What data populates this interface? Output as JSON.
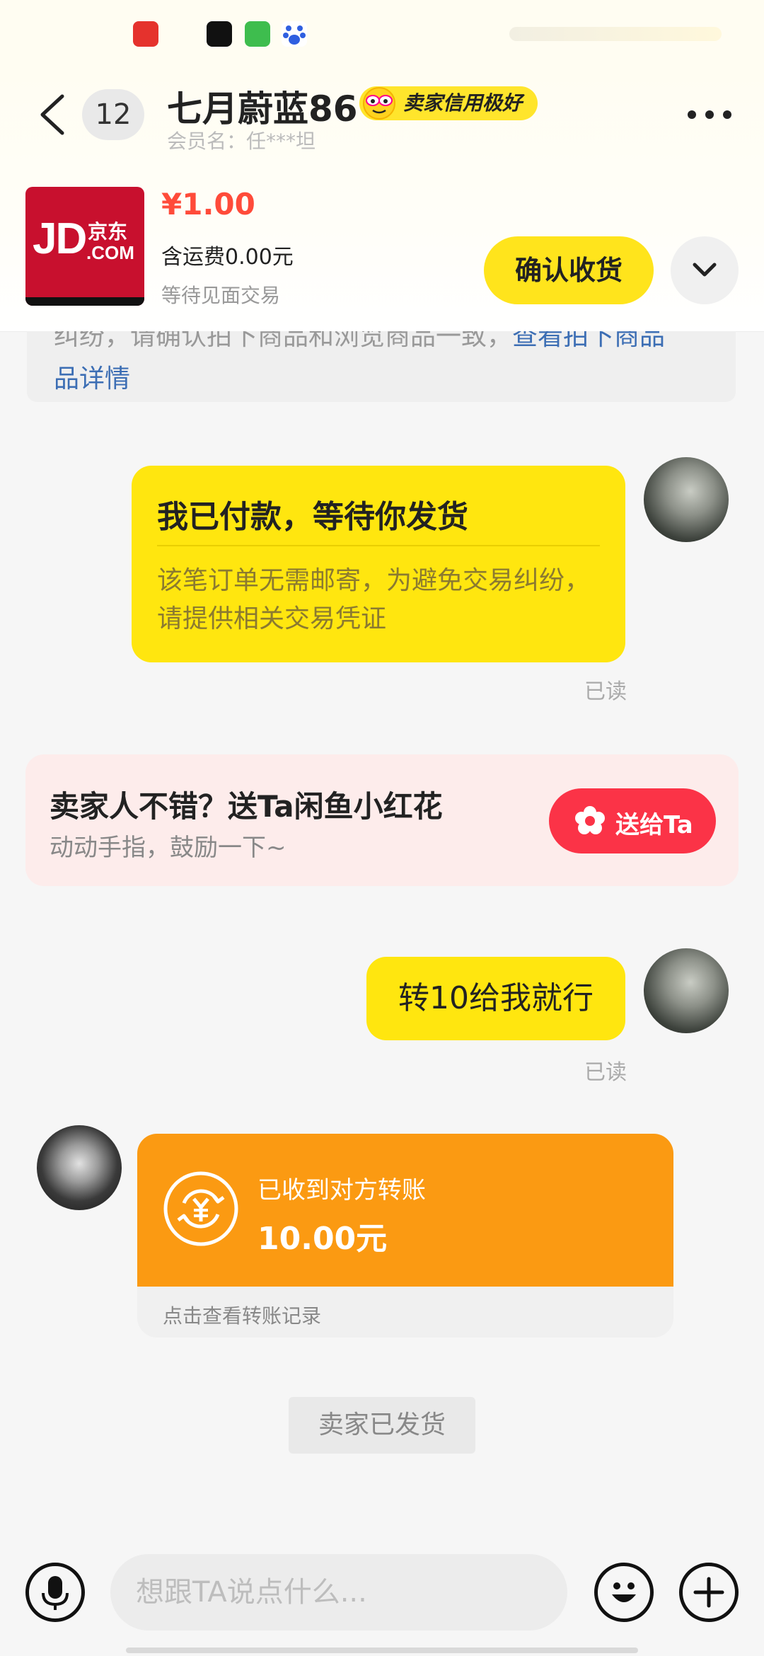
{
  "header": {
    "unread_count": "12",
    "seller_name": "七月蔚蓝86",
    "credit_badge": "卖家信用极好",
    "member_name": "会员名：任***坦",
    "back_icon": "chevron-left-icon",
    "more_icon": "more-horizontal-icon"
  },
  "order": {
    "product_logo": {
      "main": "JD",
      "cn": "京东",
      "com": ".COM"
    },
    "price": "¥1.00",
    "shipping": "含运费0.00元",
    "status": "等待见面交易",
    "confirm_label": "确认收货",
    "expand_icon": "chevron-down-icon"
  },
  "notice": {
    "line1_text": "纠纷，请确认拍下商品和浏览商品一致，",
    "line1_link": "查看拍下商品",
    "line2_link": "品详情"
  },
  "messages": {
    "payment_card": {
      "title": "我已付款，等待你发货",
      "description": "该笔订单无需邮寄，为避免交易纠纷，请提供相关交易凭证",
      "read_status": "已读"
    },
    "flower_promo": {
      "title": "卖家人不错？送Ta闲鱼小红花",
      "subtitle": "动动手指，鼓励一下~",
      "button_label": "送给Ta",
      "button_icon": "flower-icon"
    },
    "text_message": {
      "text": "转10给我就行",
      "read_status": "已读"
    },
    "transfer_card": {
      "label": "已收到对方转账",
      "amount": "10.00元",
      "link": "点击查看转账记录",
      "icon": "yuan-transfer-icon"
    },
    "system": "卖家已发货"
  },
  "input_bar": {
    "placeholder": "想跟TA说点什么...",
    "voice_icon": "microphone-icon",
    "emoji_icon": "emoji-smile-icon",
    "add_icon": "plus-icon"
  },
  "colors": {
    "brand_yellow": "#ffe60f",
    "price_red": "#ff4b3a",
    "flower_red": "#fb3347",
    "transfer_orange": "#fb9a12",
    "link_blue": "#3c6eb4"
  }
}
